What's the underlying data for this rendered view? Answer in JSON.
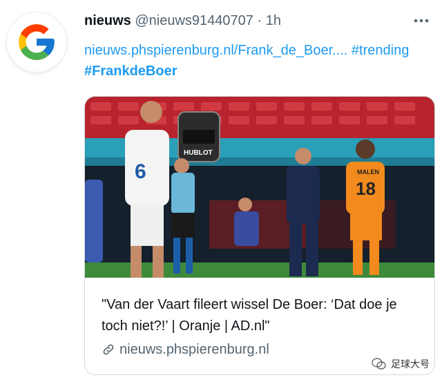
{
  "tweet": {
    "author_name": "nieuws",
    "author_handle": "@nieuws91440707",
    "separator": "·",
    "time": "1h",
    "link_text": "nieuws.phspierenburg.nl/Frank_de_Boer....",
    "hashtag1": "#trending",
    "hashtag2": "#FrankdeBoer"
  },
  "avatar": {
    "icon": "google-g-logo",
    "colors": [
      "#4285F4",
      "#EA4335",
      "#FBBC05",
      "#34A853"
    ]
  },
  "card": {
    "image_scoreboard": "HUBLOT",
    "image_player_left_number": "6",
    "image_player_right_number": "18",
    "image_player_right_name": "MALEN",
    "title": "\"Van der Vaart fileert wissel De Boer: ‘Dat doe je toch niet?!’ | Oranje | AD.nl\"",
    "domain": "nieuws.phspierenburg.nl",
    "domain_icon": "link-icon"
  },
  "watermark": {
    "text": "足球大号",
    "icon": "wechat-icon"
  },
  "colors": {
    "link": "#1d9bf0",
    "secondary": "#536471",
    "border": "#cfd9de"
  }
}
